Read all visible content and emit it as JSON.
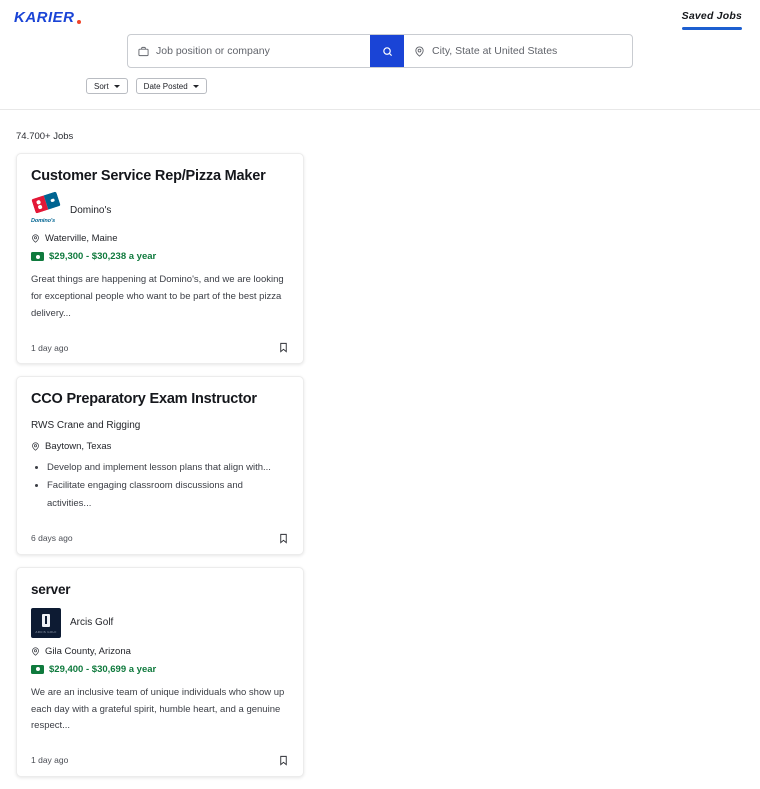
{
  "header": {
    "logo_text": "KARIER",
    "logo_color": "#1a44d6",
    "logo_dot_color": "#f0452a",
    "nav": {
      "saved_jobs_label": "Saved Jobs",
      "underline_color": "#1d5fd0"
    }
  },
  "search": {
    "keyword_placeholder": "Job position or company",
    "keyword_value": "",
    "location_placeholder": "City, State at United States",
    "location_value": "",
    "keyword_icon": "briefcase-icon",
    "location_icon": "map-pin-icon",
    "search_icon": "search-icon",
    "search_button_color": "#1a44d6"
  },
  "filters": [
    {
      "label": "Sort",
      "icon": "chevron-down-icon"
    },
    {
      "label": "Date Posted",
      "icon": "chevron-down-icon"
    }
  ],
  "results": {
    "count_label": "74.700+ Jobs",
    "jobs": [
      {
        "title": "Customer Service Rep/Pizza Maker",
        "company": "Domino's",
        "logo": "dominos-logo",
        "location": "Waterville, Maine",
        "location_icon": "map-pin-icon",
        "salary": "$29,300 - $30,238 a year",
        "salary_icon": "money-icon",
        "salary_color": "#0f7a3d",
        "description": "Great things are happening at Domino's, and we are looking for exceptional people who want to be part of the best pizza delivery...",
        "bullets": [],
        "posted": "1 day ago",
        "bookmark_icon": "bookmark-icon"
      },
      {
        "title": "CCO Preparatory Exam Instructor",
        "company": "RWS Crane and Rigging",
        "logo": "",
        "location": "Baytown, Texas",
        "location_icon": "map-pin-icon",
        "salary": "",
        "salary_icon": "",
        "salary_color": "",
        "description": "",
        "bullets": [
          "Develop and implement lesson plans that align with...",
          "Facilitate engaging classroom discussions and activities..."
        ],
        "posted": "6 days ago",
        "bookmark_icon": "bookmark-icon"
      },
      {
        "title": "server",
        "company": "Arcis Golf",
        "logo": "arcis-golf-logo",
        "location": "Gila County, Arizona",
        "location_icon": "map-pin-icon",
        "salary": "$29,400 - $30,699 a year",
        "salary_icon": "money-icon",
        "salary_color": "#0f7a3d",
        "description": "We are an inclusive team of unique individuals who show up each day with a grateful spirit, humble heart, and a genuine respect...",
        "bullets": [],
        "posted": "1 day ago",
        "bookmark_icon": "bookmark-icon"
      }
    ]
  }
}
